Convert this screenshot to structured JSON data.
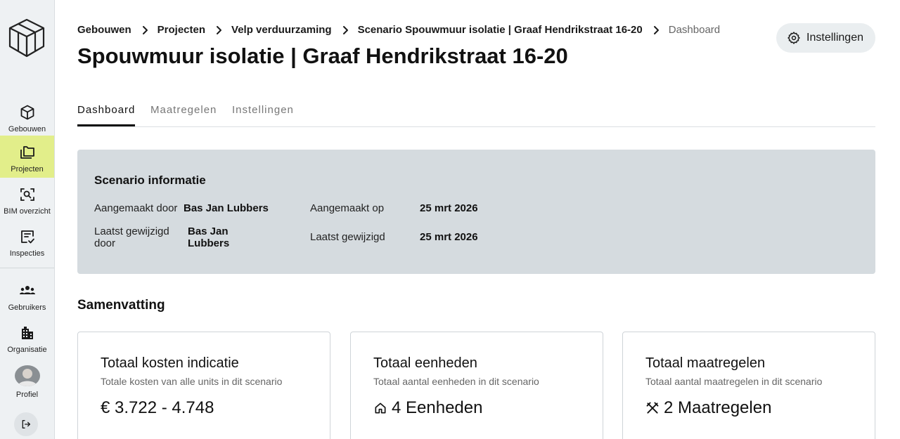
{
  "sidebar": {
    "items": [
      {
        "label": "Gebouwen",
        "icon": "cube-icon"
      },
      {
        "label": "Projecten",
        "icon": "folders-icon",
        "active": true
      },
      {
        "label": "BIM overzicht",
        "icon": "scan-search-icon"
      },
      {
        "label": "Inspecties",
        "icon": "checklist-icon"
      },
      {
        "label": "Gebruikers",
        "icon": "users-icon"
      },
      {
        "label": "Organisatie",
        "icon": "building-icon"
      },
      {
        "label": "Profiel",
        "icon": "avatar"
      }
    ],
    "logout_icon": "logout-icon"
  },
  "breadcrumb": {
    "items": [
      "Gebouwen",
      "Projecten",
      "Velp verduurzaming",
      "Scenario Spouwmuur isolatie | Graaf Hendrikstraat 16-20"
    ],
    "current": "Dashboard"
  },
  "header": {
    "title": "Spouwmuur isolatie | Graaf Hendrikstraat 16-20",
    "settings_label": "Instellingen"
  },
  "tabs": [
    "Dashboard",
    "Maatregelen",
    "Instellingen"
  ],
  "scenario_info": {
    "title": "Scenario informatie",
    "created_by_label": "Aangemaakt door",
    "created_by_value": "Bas Jan Lubbers",
    "created_on_label": "Aangemaakt op",
    "created_on_value": "25 mrt 2026",
    "modified_by_label_line1": "Laatst gewijzigd",
    "modified_by_label_line2": "door",
    "modified_by_value_line1": "Bas Jan",
    "modified_by_value_line2": "Lubbers",
    "modified_on_label": "Laatst gewijzigd",
    "modified_on_value": "25 mrt 2026"
  },
  "summary": {
    "title": "Samenvatting",
    "cards": [
      {
        "title": "Totaal kosten indicatie",
        "subtitle": "Totale kosten van alle units in dit scenario",
        "value": "€ 3.722 - 4.748",
        "icon": ""
      },
      {
        "title": "Totaal eenheden",
        "subtitle": "Totaal aantal eenheden in dit scenario",
        "value": "4 Eenheden",
        "icon": "home-icon"
      },
      {
        "title": "Totaal maatregelen",
        "subtitle": "Totaal aantal maatregelen in dit scenario",
        "value": "2 Maatregelen",
        "icon": "tools-icon"
      }
    ]
  },
  "colors": {
    "active_nav": "#e2ee8a",
    "info_panel": "#d5dbdf",
    "sidebar_bg": "#eef1f3"
  }
}
